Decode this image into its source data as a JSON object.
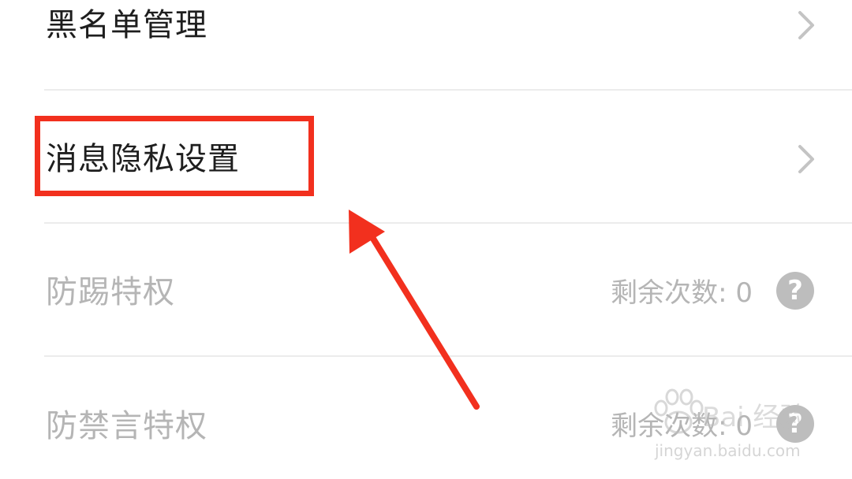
{
  "settings": {
    "rows": [
      {
        "label": "黑名单管理",
        "has_chevron": true
      },
      {
        "label": "消息隐私设置",
        "has_chevron": true
      },
      {
        "label": "防踢特权",
        "remaining_text": "剩余次数: 0"
      },
      {
        "label": "防禁言特权",
        "remaining_text": "剩余次数: 0"
      }
    ],
    "help_glyph": "?",
    "chevron_glyph": "›"
  },
  "watermark": {
    "text": "Bai 经验",
    "url": "jingyan.baidu.com"
  },
  "colors": {
    "annotation_red": "#f2301e",
    "text_primary": "#1e1e1e",
    "text_disabled": "#b5b5b5",
    "divider": "#ececec",
    "help_icon_bg": "#bdbdbd"
  },
  "icons": {
    "chevron": "chevron-right-icon",
    "help": "question-circle-icon",
    "arrow": "arrow-annotation"
  }
}
